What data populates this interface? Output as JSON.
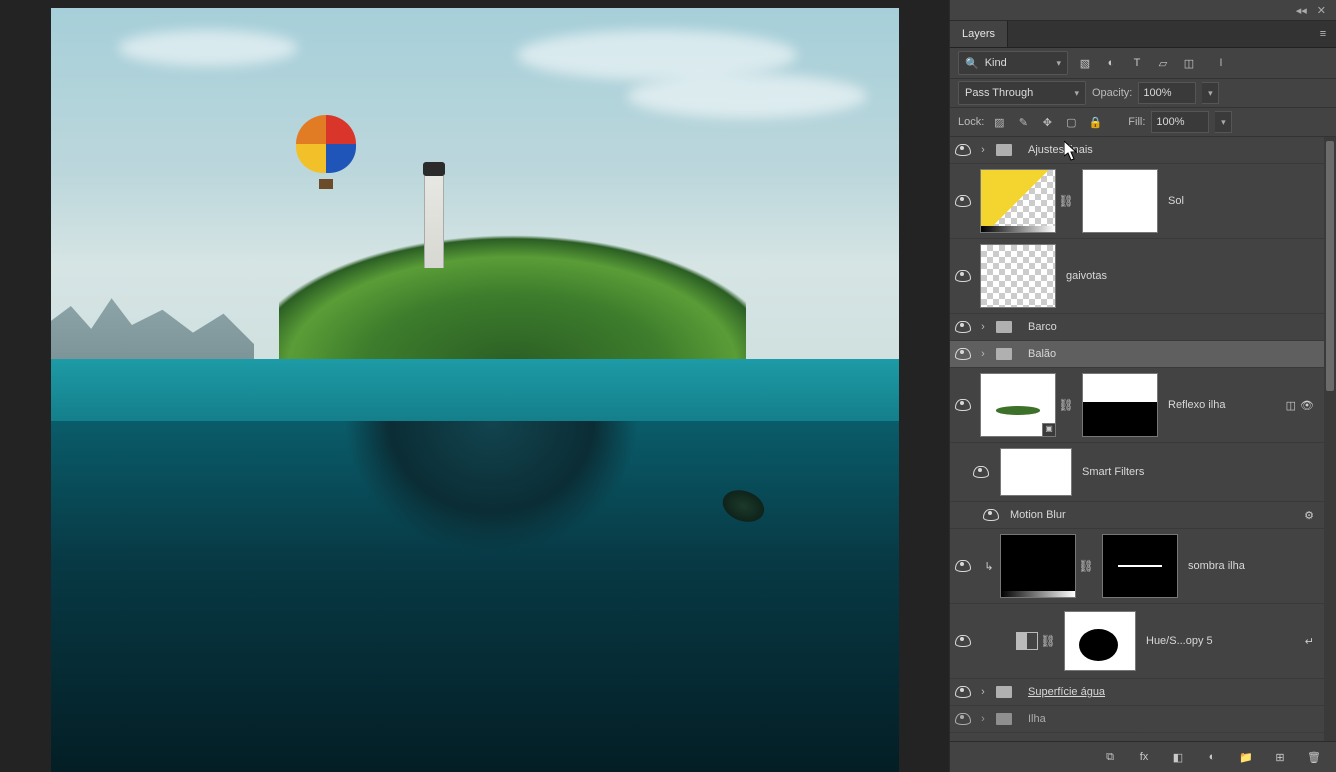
{
  "panel": {
    "tab": "Layers",
    "filter_label": "Kind",
    "blend_mode": "Pass Through",
    "opacity_label": "Opacity:",
    "opacity_value": "100%",
    "lock_label": "Lock:",
    "fill_label": "Fill:",
    "fill_value": "100%"
  },
  "layers": {
    "ajustes_finais": "Ajustes finais",
    "sol": "Sol",
    "gaivotas": "gaivotas",
    "barco": "Barco",
    "balao": "Balão",
    "reflexo_ilha": "Reflexo ilha",
    "smart_filters": "Smart Filters",
    "motion_blur": "Motion Blur",
    "sombra_ilha": "sombra ilha",
    "hue_sat": "Hue/S...opy 5",
    "superficie_agua": "Superfície água",
    "ilha": "Ilha"
  },
  "icons": {
    "search": "🔍",
    "chevron": "▾",
    "twist": "›",
    "link": "⛓",
    "settings": "≡",
    "fx": "fx",
    "mask": "◧",
    "adj": "◐",
    "group": "📁",
    "new": "⊞",
    "trash": "🗑",
    "chain": "⧉",
    "arrow_dbl": "◂◂",
    "cross": "✕"
  }
}
